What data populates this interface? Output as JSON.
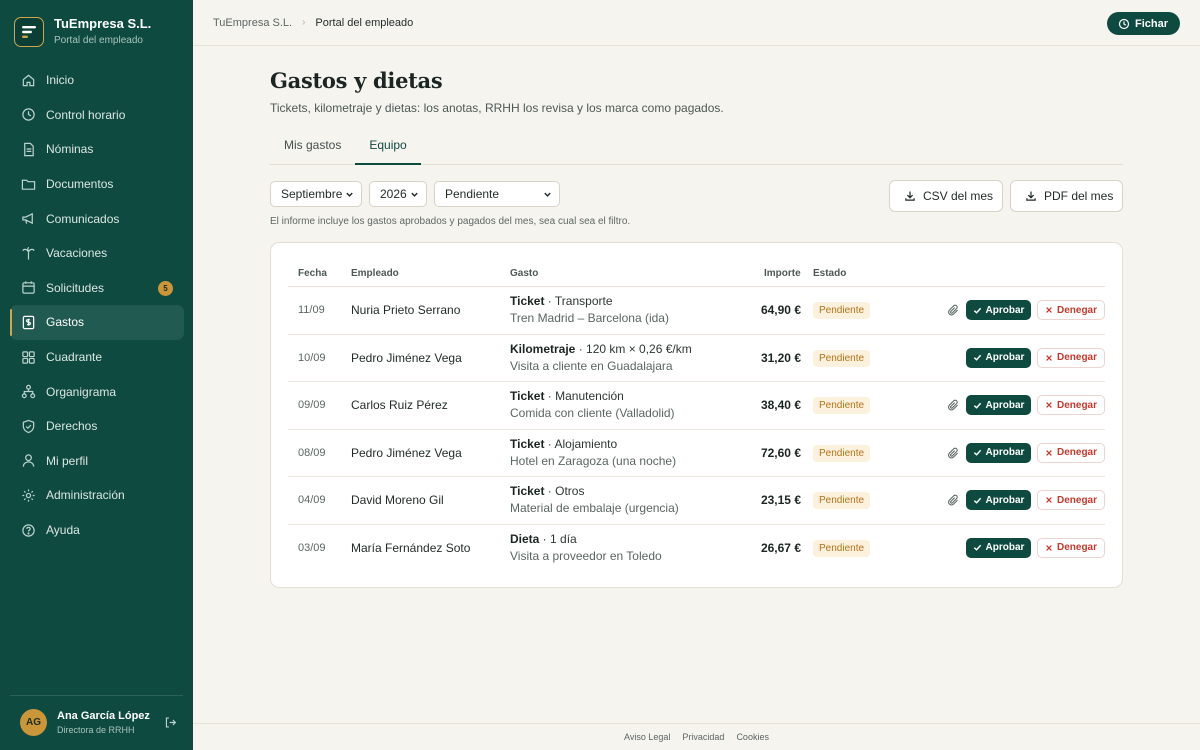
{
  "brand": {
    "name": "TuEmpresa S.L.",
    "subtitle": "Portal del empleado"
  },
  "nav": {
    "items": [
      {
        "label": "Inicio",
        "icon": "home-icon"
      },
      {
        "label": "Control horario",
        "icon": "clock-icon"
      },
      {
        "label": "Nóminas",
        "icon": "document-icon"
      },
      {
        "label": "Documentos",
        "icon": "folder-icon"
      },
      {
        "label": "Comunicados",
        "icon": "megaphone-icon"
      },
      {
        "label": "Vacaciones",
        "icon": "palm-tree-icon"
      },
      {
        "label": "Solicitudes",
        "icon": "calendar-icon",
        "badge": "5"
      },
      {
        "label": "Gastos",
        "icon": "receipt-icon",
        "active": true
      },
      {
        "label": "Cuadrante",
        "icon": "grid-icon"
      },
      {
        "label": "Organigrama",
        "icon": "org-chart-icon"
      },
      {
        "label": "Derechos",
        "icon": "shield-icon"
      },
      {
        "label": "Mi perfil",
        "icon": "user-icon"
      },
      {
        "label": "Administración",
        "icon": "gear-icon"
      },
      {
        "label": "Ayuda",
        "icon": "help-icon"
      }
    ]
  },
  "user": {
    "initials": "AG",
    "name": "Ana García López",
    "role": "Directora de RRHH"
  },
  "topbar": {
    "breadcrumb": [
      "TuEmpresa S.L.",
      "Portal del empleado"
    ],
    "fichar_label": "Fichar"
  },
  "page": {
    "title": "Gastos y dietas",
    "subtitle": "Tickets, kilometraje y dietas: los anotas, RRHH los revisa y los marca como pagados.",
    "tabs": [
      {
        "label": "Mis gastos",
        "active": false
      },
      {
        "label": "Equipo",
        "active": true
      }
    ],
    "filters": {
      "month": "Septiembre",
      "year": "2026",
      "status": "Pendiente"
    },
    "export_csv": "CSV del mes",
    "export_pdf": "PDF del mes",
    "note": "El informe incluye los gastos aprobados y pagados del mes, sea cual sea el filtro."
  },
  "table": {
    "headers": {
      "fecha": "Fecha",
      "empleado": "Empleado",
      "gasto": "Gasto",
      "importe": "Importe",
      "estado": "Estado"
    },
    "approve_label": "Aprobar",
    "deny_label": "Denegar",
    "rows": [
      {
        "fecha": "11/09",
        "empleado": "Nuria Prieto Serrano",
        "tipo": "Ticket",
        "detalle": " · Transporte",
        "descripcion": "Tren Madrid – Barcelona (ida)",
        "importe": "64,90 €",
        "estado": "Pendiente",
        "adjunto": true
      },
      {
        "fecha": "10/09",
        "empleado": "Pedro Jiménez Vega",
        "tipo": "Kilometraje",
        "detalle": " · 120 km × 0,26 €/km",
        "descripcion": "Visita a cliente en Guadalajara",
        "importe": "31,20 €",
        "estado": "Pendiente",
        "adjunto": false
      },
      {
        "fecha": "09/09",
        "empleado": "Carlos Ruiz Pérez",
        "tipo": "Ticket",
        "detalle": " · Manutención",
        "descripcion": "Comida con cliente (Valladolid)",
        "importe": "38,40 €",
        "estado": "Pendiente",
        "adjunto": true
      },
      {
        "fecha": "08/09",
        "empleado": "Pedro Jiménez Vega",
        "tipo": "Ticket",
        "detalle": " · Alojamiento",
        "descripcion": "Hotel en Zaragoza (una noche)",
        "importe": "72,60 €",
        "estado": "Pendiente",
        "adjunto": true
      },
      {
        "fecha": "04/09",
        "empleado": "David Moreno Gil",
        "tipo": "Ticket",
        "detalle": " · Otros",
        "descripcion": "Material de embalaje (urgencia)",
        "importe": "23,15 €",
        "estado": "Pendiente",
        "adjunto": true
      },
      {
        "fecha": "03/09",
        "empleado": "María Fernández Soto",
        "tipo": "Dieta",
        "detalle": " · 1 día",
        "descripcion": "Visita a proveedor en Toledo",
        "importe": "26,67 €",
        "estado": "Pendiente",
        "adjunto": false
      }
    ]
  },
  "footer": {
    "links": [
      "Aviso Legal",
      "Privacidad",
      "Cookies"
    ]
  },
  "colors": {
    "primary": "#0e4a40",
    "accent": "#d1a64a",
    "pending_bg": "#fbf1dd",
    "pending_text": "#b5721b",
    "deny": "#c23a2c"
  }
}
